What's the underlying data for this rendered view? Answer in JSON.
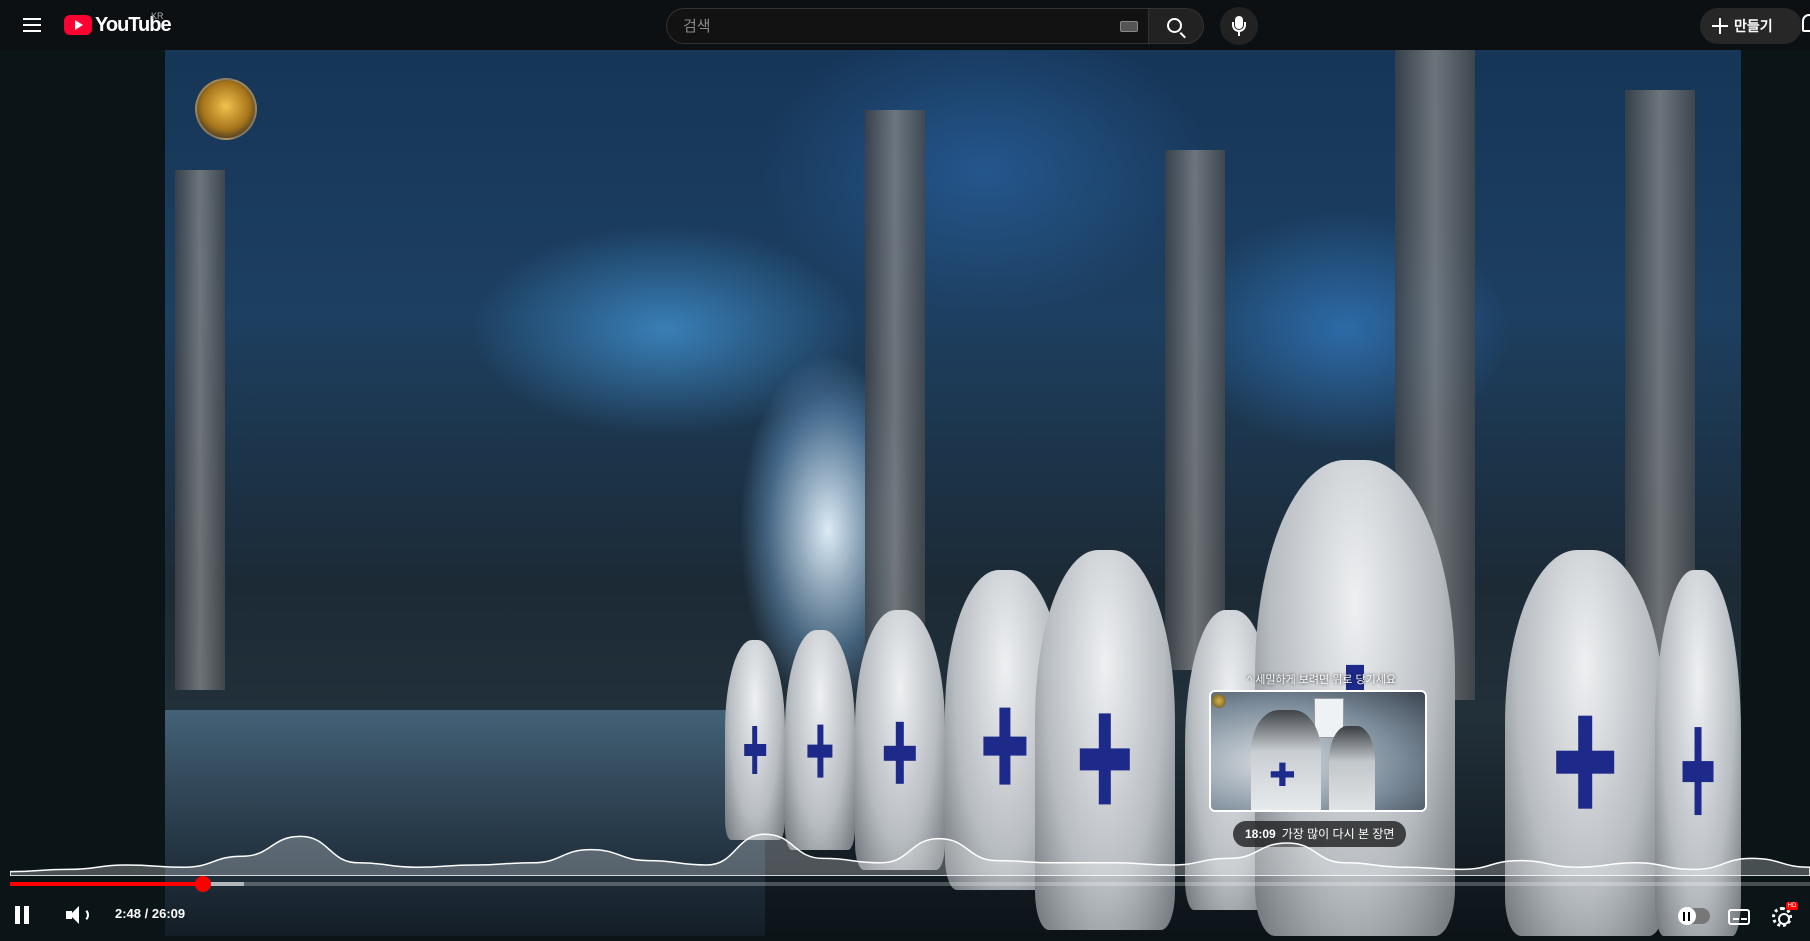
{
  "header": {
    "logo_text": "YouTube",
    "country_code": "KR",
    "search_placeholder": "검색",
    "create_label": "만들기"
  },
  "player": {
    "current_time": "2:48",
    "duration": "26:09",
    "time_display": "2:48 / 26:09",
    "played_fraction": 0.107,
    "buffered_fraction": 0.13,
    "preview": {
      "hint": "^ 세밀하게 보려면 위로 당기세요",
      "timestamp": "18:09",
      "label": "가장 많이 다시 본 장면",
      "hover_fraction": 0.73
    },
    "heatmap": [
      0.1,
      0.15,
      0.25,
      0.2,
      0.45,
      0.9,
      0.3,
      0.2,
      0.25,
      0.3,
      0.6,
      0.35,
      0.25,
      0.95,
      0.4,
      0.3,
      0.85,
      0.35,
      0.3,
      0.3,
      0.25,
      0.4,
      0.75,
      0.3,
      0.2,
      0.15,
      0.35,
      0.2,
      0.3,
      0.15,
      0.4,
      0.2
    ]
  },
  "colors": {
    "accent": "#ff0000",
    "brand": "#ff0033",
    "header_bg": "#0d1012"
  }
}
